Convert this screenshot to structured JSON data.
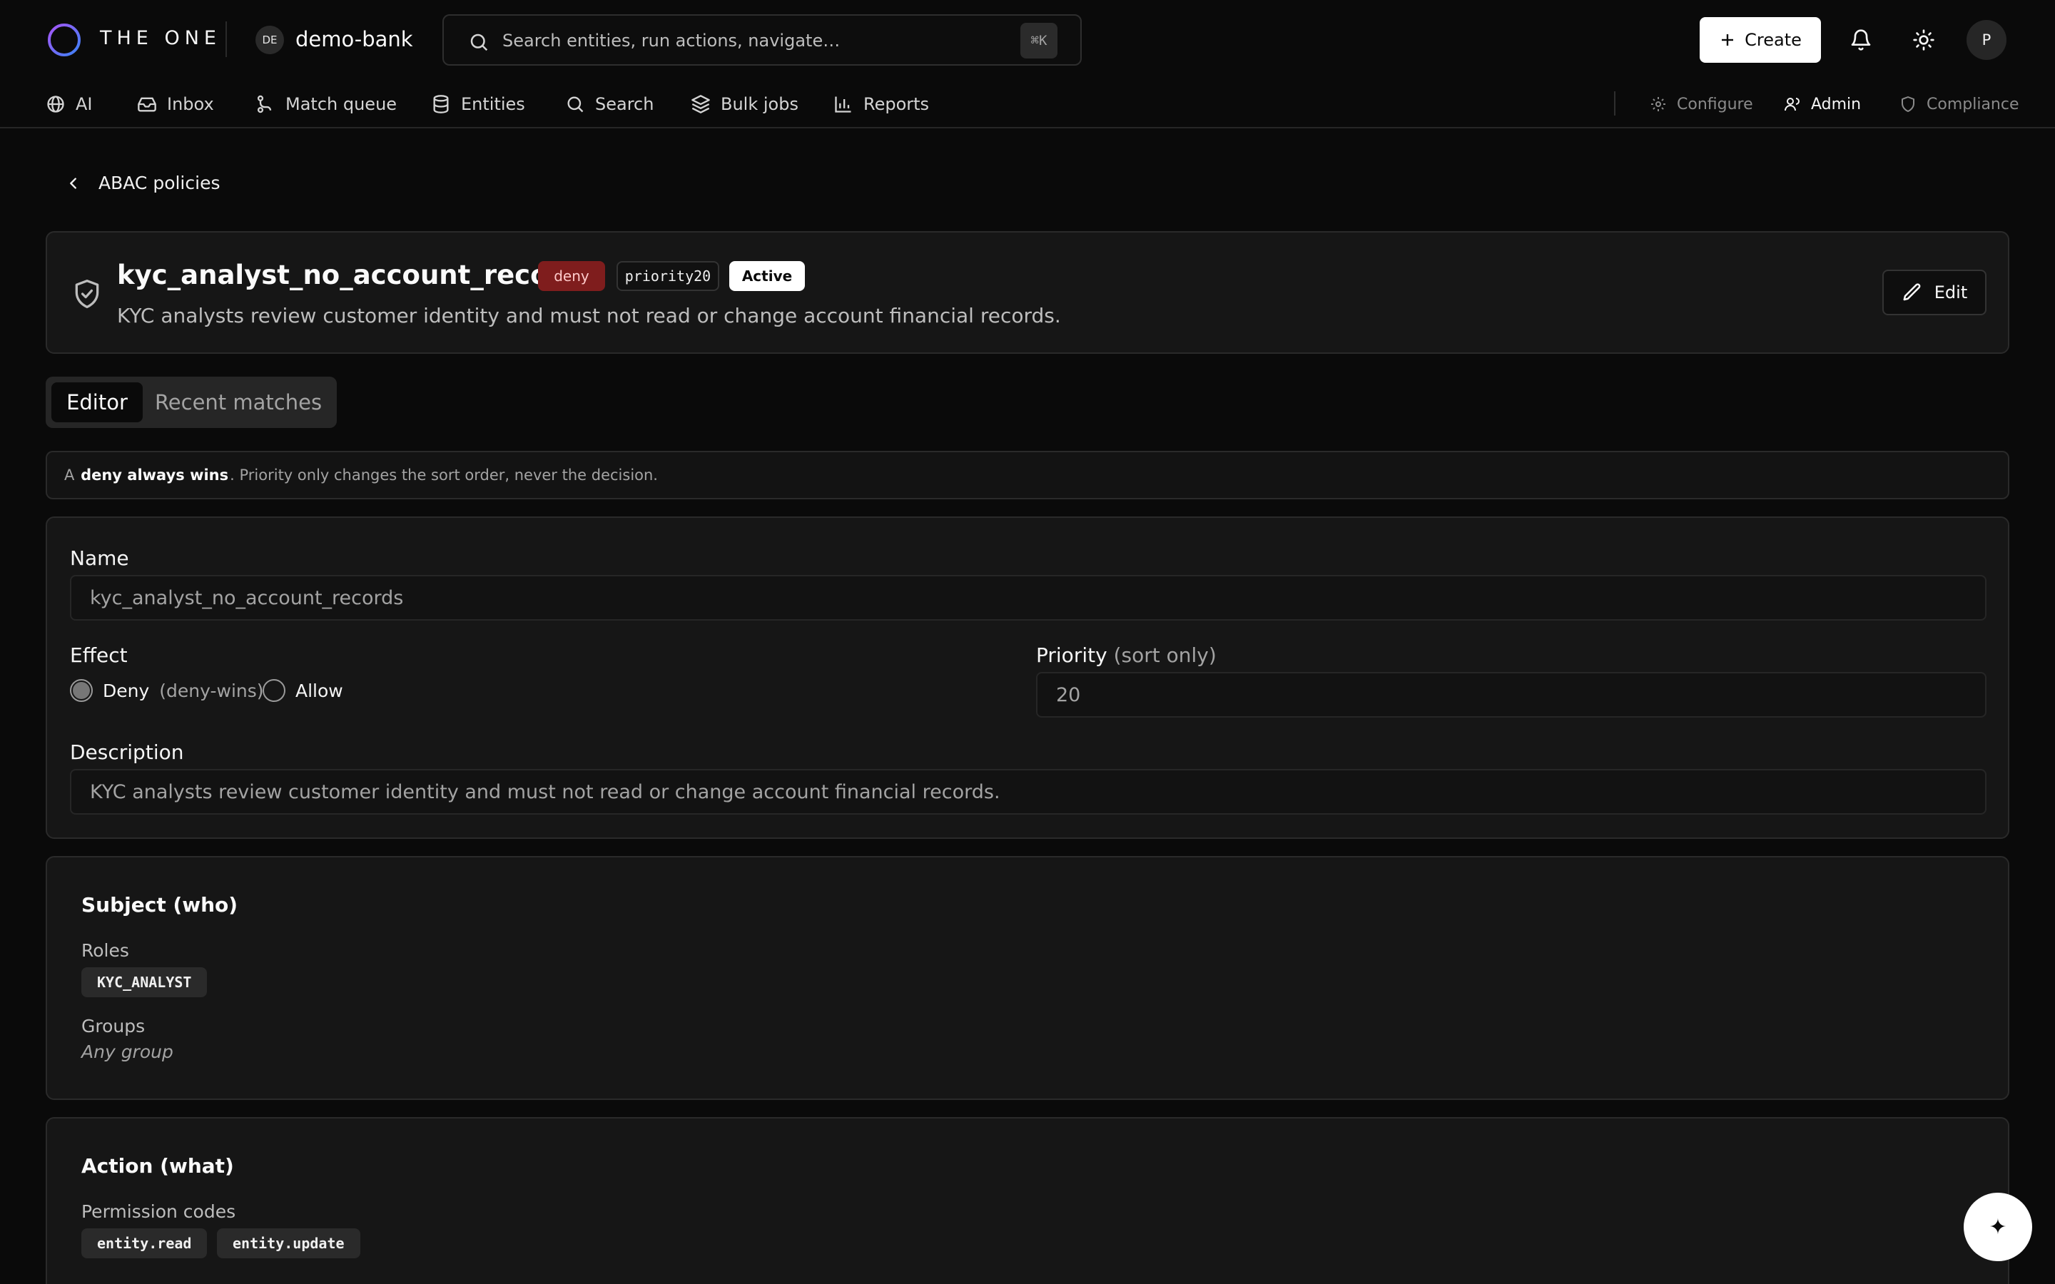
{
  "header": {
    "brand": "THE ONE",
    "workspace_initials": "DE",
    "workspace_name": "demo-bank",
    "search_placeholder": "Search entities, run actions, navigate…",
    "search_shortcut": "⌘K",
    "create_label": "Create",
    "user_initial": "P"
  },
  "nav": {
    "items": [
      {
        "label": "AI",
        "icon": "globe-icon"
      },
      {
        "label": "Inbox",
        "icon": "inbox-icon"
      },
      {
        "label": "Match queue",
        "icon": "route-icon"
      },
      {
        "label": "Entities",
        "icon": "database-icon"
      },
      {
        "label": "Search",
        "icon": "search-icon"
      },
      {
        "label": "Bulk jobs",
        "icon": "layers-icon"
      },
      {
        "label": "Reports",
        "icon": "bar-chart-icon"
      }
    ],
    "right_items": [
      {
        "label": "Configure",
        "icon": "gear-icon",
        "active": false
      },
      {
        "label": "Admin",
        "icon": "users-icon",
        "active": true
      },
      {
        "label": "Compliance",
        "icon": "shield-icon",
        "active": false
      }
    ]
  },
  "breadcrumb": {
    "back_label": "ABAC policies"
  },
  "policy": {
    "name": "kyc_analyst_no_account_records",
    "effect_badge": "deny",
    "priority_badge": "priority20",
    "status_badge": "Active",
    "description": "KYC analysts review customer identity and must not read or change account financial records.",
    "edit_label": "Edit"
  },
  "tabs": [
    {
      "label": "Editor",
      "active": true
    },
    {
      "label": "Recent matches",
      "active": false
    }
  ],
  "notice": {
    "prefix": "A",
    "emphasis": "deny always wins",
    "suffix": ". Priority only changes the sort order, never the decision."
  },
  "form": {
    "name_label": "Name",
    "name_value": "kyc_analyst_no_account_records",
    "effect_label": "Effect",
    "effect_options": [
      {
        "label": "Deny",
        "hint": "(deny-wins)",
        "selected": true
      },
      {
        "label": "Allow",
        "hint": "",
        "selected": false
      }
    ],
    "priority_label": "Priority",
    "priority_hint": "(sort only)",
    "priority_value": "20",
    "description_label": "Description",
    "description_value": "KYC analysts review customer identity and must not read or change account financial records."
  },
  "subject": {
    "title": "Subject (who)",
    "roles_label": "Roles",
    "roles": [
      "KYC_ANALYST"
    ],
    "groups_label": "Groups",
    "groups_empty": "Any group"
  },
  "action": {
    "title": "Action (what)",
    "permissions_label": "Permission codes",
    "permissions": [
      "entity.read",
      "entity.update"
    ]
  },
  "fab": {
    "icon": "sparkle-icon",
    "glyph": "✦"
  },
  "colors": {
    "background": "#0a0a0a",
    "card": "#161616",
    "deny_badge": "#7f1d1d",
    "accent_gradient": [
      "#a855f7",
      "#3b82f6"
    ]
  }
}
